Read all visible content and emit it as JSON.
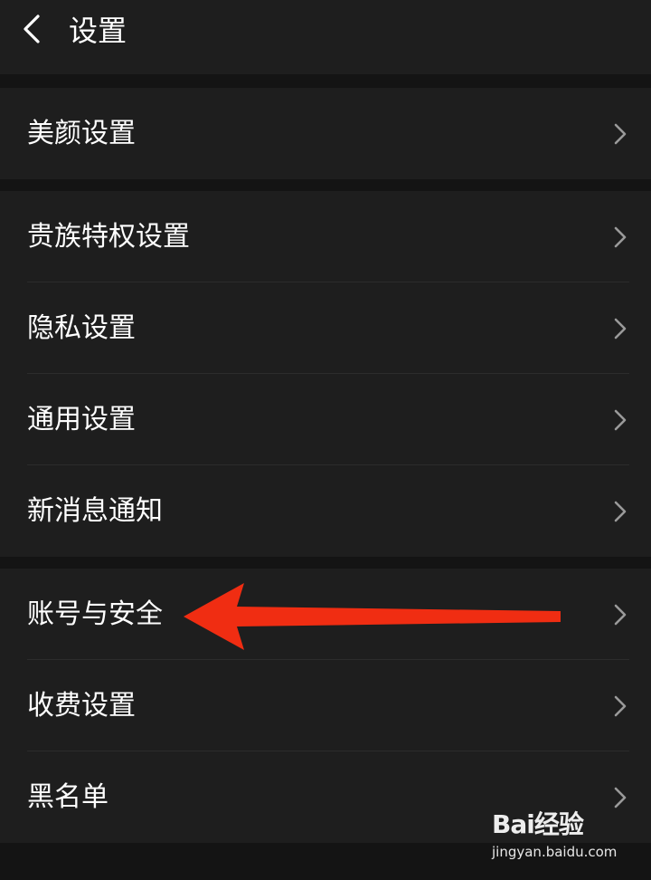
{
  "header": {
    "title": "设置",
    "back_icon": "chevron-left-icon"
  },
  "groups": [
    {
      "items": [
        {
          "label": "美颜设置"
        }
      ]
    },
    {
      "items": [
        {
          "label": "贵族特权设置"
        },
        {
          "label": "隐私设置"
        },
        {
          "label": "通用设置"
        },
        {
          "label": "新消息通知"
        }
      ]
    },
    {
      "items": [
        {
          "label": "账号与安全"
        },
        {
          "label": "收费设置"
        },
        {
          "label": "黑名单"
        }
      ]
    }
  ],
  "annotation": {
    "arrow_color": "#f02d12"
  },
  "watermark": {
    "brand": "Bai经验",
    "url": "jingyan.baidu.com"
  },
  "colors": {
    "background": "#1e1e1e",
    "separator": "#141414",
    "text": "#ffffff",
    "chevron": "#9a9a9a"
  }
}
